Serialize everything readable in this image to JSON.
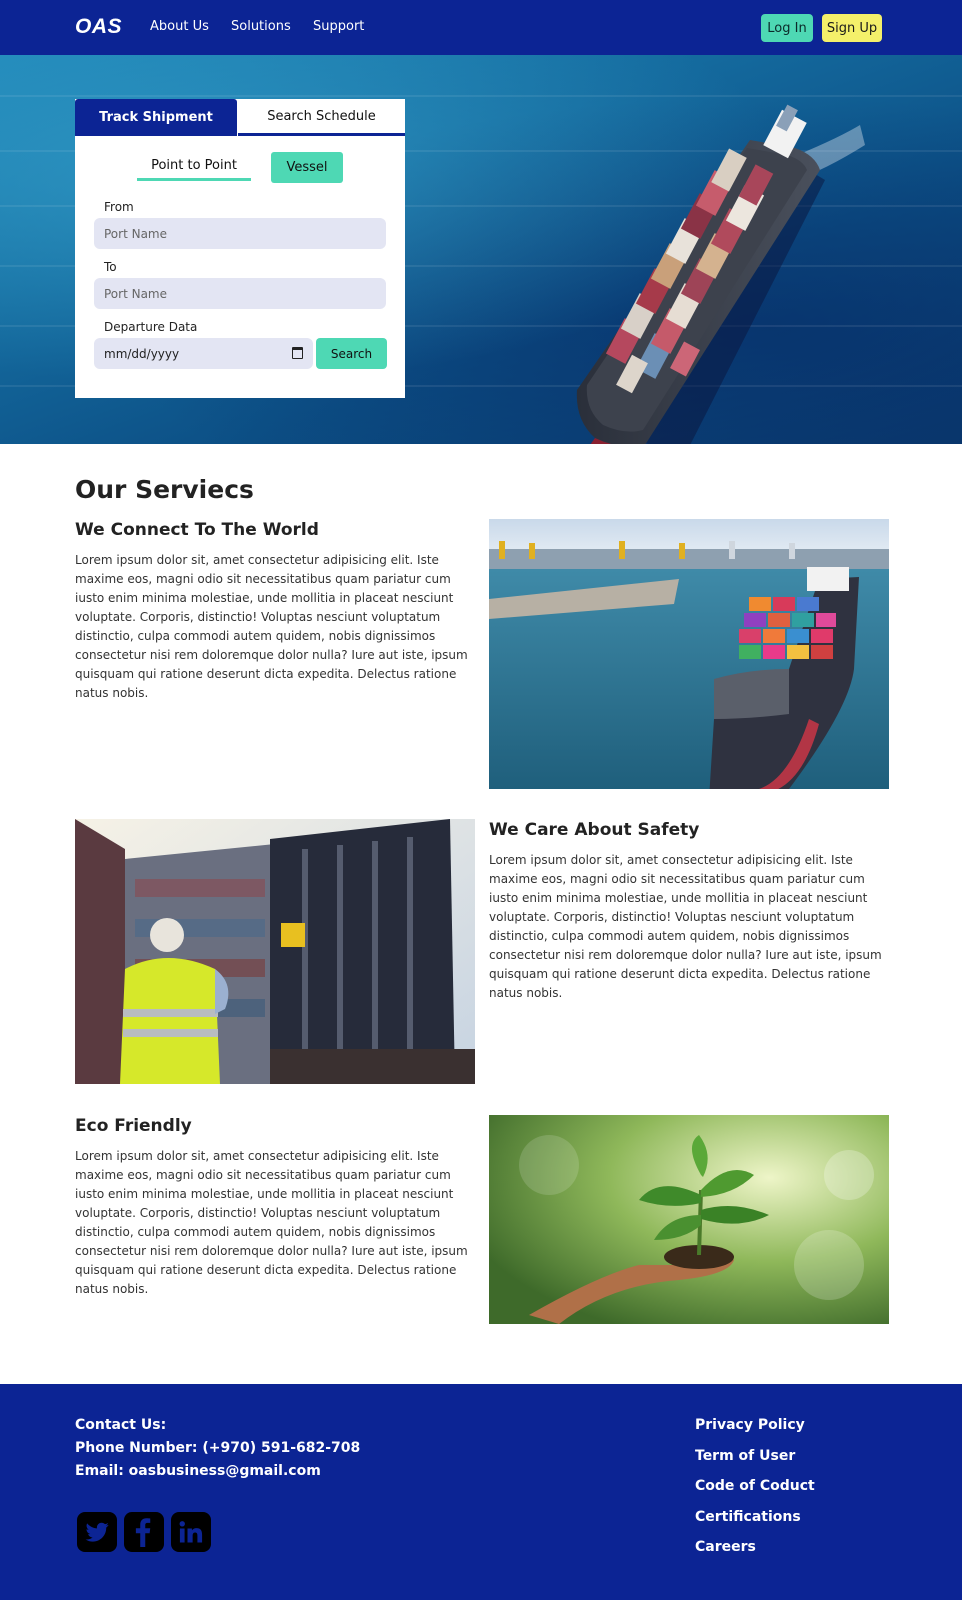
{
  "navbar": {
    "logo": "OAS",
    "links": [
      "About Us",
      "Solutions",
      "Support"
    ],
    "login_label": "Log In",
    "signup_label": "Sign Up"
  },
  "search_card": {
    "tabs": [
      "Track Shipment",
      "Search Schedule"
    ],
    "active_tab": "Track Shipment",
    "subtabs": [
      "Point to Point",
      "Vessel"
    ],
    "from_label": "From",
    "from_placeholder": "Port Name",
    "to_label": "To",
    "to_placeholder": "Port Name",
    "date_label": "Departure Data",
    "date_placeholder": "mm/dd/yyyy",
    "search_label": "Search"
  },
  "services": {
    "title": "Our Serviecs",
    "items": [
      {
        "heading": "We Connect To The World",
        "text": "Lorem ipsum dolor sit, amet consectetur adipisicing elit. Iste maxime eos, magni odio sit necessitatibus quam pariatur cum iusto enim minima molestiae, unde mollitia in placeat nesciunt voluptate. Corporis, distinctio! Voluptas nesciunt voluptatum distinctio, culpa commodi autem quidem, nobis dignissimos consectetur nisi rem doloremque dolor nulla? Iure aut iste, ipsum quisquam qui ratione deserunt dicta expedita. Delectus ratione natus nobis."
      },
      {
        "heading": "We Care About Safety",
        "text": "Lorem ipsum dolor sit, amet consectetur adipisicing elit. Iste maxime eos, magni odio sit necessitatibus quam pariatur cum iusto enim minima molestiae, unde mollitia in placeat nesciunt voluptate. Corporis, distinctio! Voluptas nesciunt voluptatum distinctio, culpa commodi autem quidem, nobis dignissimos consectetur nisi rem doloremque dolor nulla? Iure aut iste, ipsum quisquam qui ratione deserunt dicta expedita. Delectus ratione natus nobis."
      },
      {
        "heading": "Eco Friendly",
        "text": "Lorem ipsum dolor sit, amet consectetur adipisicing elit. Iste maxime eos, magni odio sit necessitatibus quam pariatur cum iusto enim minima molestiae, unde mollitia in placeat nesciunt voluptate. Corporis, distinctio! Voluptas nesciunt voluptatum distinctio, culpa commodi autem quidem, nobis dignissimos consectetur nisi rem doloremque dolor nulla? Iure aut iste, ipsum quisquam qui ratione deserunt dicta expedita. Delectus ratione natus nobis."
      }
    ]
  },
  "footer": {
    "contact_title": "Contact Us:",
    "phone": "Phone Number: (+970) 591-682-708",
    "email": "Email: oasbusiness@gmail.com",
    "links": [
      "Privacy Policy",
      "Term of User",
      "Code of Coduct",
      "Certifications",
      "Careers"
    ],
    "social_icons": [
      "twitter-icon",
      "facebook-icon",
      "linkedin-icon"
    ]
  },
  "colors": {
    "primary": "#0c2494",
    "accent": "#4ed8b4",
    "signup": "#f4f06a",
    "input_bg": "#e3e5f3"
  }
}
